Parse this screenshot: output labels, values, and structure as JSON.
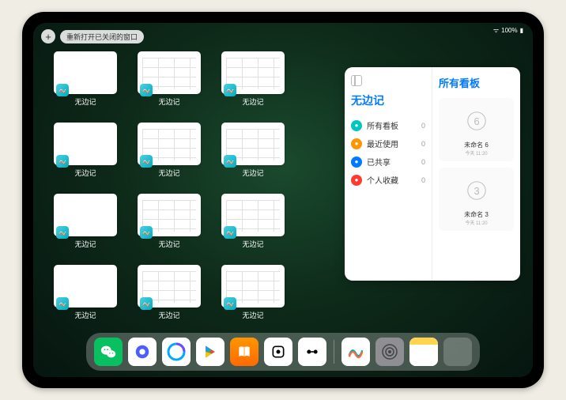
{
  "status": {
    "battery": "100%"
  },
  "top": {
    "reopen_label": "重新打开已关闭的窗口",
    "plus": "+"
  },
  "app_name": "无边记",
  "thumbs": [
    {
      "label": "无边记",
      "style": "blank"
    },
    {
      "label": "无边记",
      "style": "grid"
    },
    {
      "label": "无边记",
      "style": "grid"
    },
    {
      "label": "无边记",
      "style": "blank"
    },
    {
      "label": "无边记",
      "style": "grid"
    },
    {
      "label": "无边记",
      "style": "grid"
    },
    {
      "label": "无边记",
      "style": "blank"
    },
    {
      "label": "无边记",
      "style": "grid"
    },
    {
      "label": "无边记",
      "style": "grid"
    },
    {
      "label": "无边记",
      "style": "blank"
    },
    {
      "label": "无边记",
      "style": "grid"
    },
    {
      "label": "无边记",
      "style": "grid"
    }
  ],
  "panel": {
    "left_title": "无边记",
    "right_title": "所有看板",
    "items": [
      {
        "icon_color": "#00c7be",
        "label": "所有看板",
        "count": "0"
      },
      {
        "icon_color": "#ff9500",
        "label": "最近使用",
        "count": "0"
      },
      {
        "icon_color": "#007aff",
        "label": "已共享",
        "count": "0"
      },
      {
        "icon_color": "#ff3b30",
        "label": "个人收藏",
        "count": "0"
      }
    ],
    "boards": [
      {
        "name": "未命名 6",
        "date": "今天 11:20",
        "digit": "6"
      },
      {
        "name": "未命名 3",
        "date": "今天 11:20",
        "digit": "3"
      }
    ]
  },
  "dock": [
    {
      "name": "wechat",
      "bg": "#07c160"
    },
    {
      "name": "quark",
      "bg": "#fff"
    },
    {
      "name": "qqbrowser",
      "bg": "#fff"
    },
    {
      "name": "play",
      "bg": "#fff"
    },
    {
      "name": "books",
      "bg": "linear-gradient(#ff9500,#ff6a00)"
    },
    {
      "name": "dice",
      "bg": "#fff"
    },
    {
      "name": "connect",
      "bg": "#fff"
    },
    {
      "name": "freeform",
      "bg": "#fff"
    },
    {
      "name": "settings",
      "bg": "#8e8e93"
    },
    {
      "name": "notes",
      "bg": "#fff"
    },
    {
      "name": "recent",
      "bg": "multi"
    }
  ]
}
